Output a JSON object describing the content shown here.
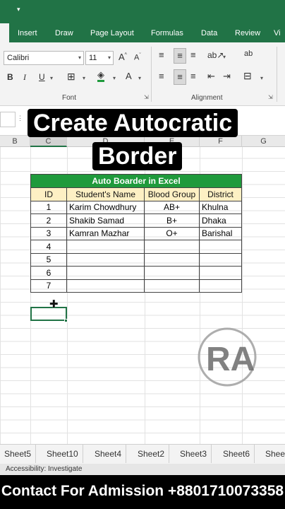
{
  "ribbon_tabs": [
    "Insert",
    "Draw",
    "Page Layout",
    "Formulas",
    "Data",
    "Review",
    "Vi"
  ],
  "font": {
    "name": "Calibri",
    "size": "11",
    "group_label": "Font"
  },
  "alignment": {
    "group_label": "Alignment"
  },
  "overlay": {
    "line1": "Create Autocratic",
    "line2": "Border"
  },
  "columns": [
    "B",
    "C",
    "D",
    "E",
    "F",
    "G"
  ],
  "table": {
    "title": "Auto Boarder in Excel",
    "headers": [
      "ID",
      "Student's Name",
      "Blood Group",
      "District"
    ],
    "rows": [
      [
        "1",
        "Karim Chowdhury",
        "AB+",
        "Khulna"
      ],
      [
        "2",
        "Shakib Samad",
        "B+",
        "Dhaka"
      ],
      [
        "3",
        "Kamran Mazhar",
        "O+",
        "Barishal"
      ],
      [
        "4",
        "",
        "",
        ""
      ],
      [
        "5",
        "",
        "",
        ""
      ],
      [
        "6",
        "",
        "",
        ""
      ],
      [
        "7",
        "",
        "",
        ""
      ]
    ]
  },
  "watermark": {
    "mark": "RA"
  },
  "sheet_tabs": [
    "Sheet5",
    "Sheet10",
    "Sheet4",
    "Sheet2",
    "Sheet3",
    "Sheet6",
    "Shee"
  ],
  "status": {
    "text": "Accessibility: Investigate"
  },
  "banner": {
    "text": "Contact For Admission +8801710073358"
  },
  "colors": {
    "excel_green": "#217346",
    "table_title": "#1f9a3c",
    "header_fill": "#fdf0c4"
  }
}
